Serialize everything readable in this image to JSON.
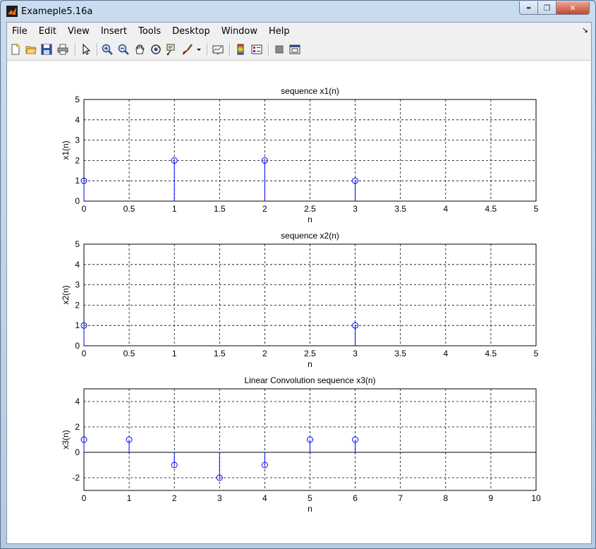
{
  "window": {
    "title": "Exameple5.16a",
    "controls": {
      "minimize": "▬",
      "maximize": "❐",
      "close": "✕"
    }
  },
  "menu": [
    "File",
    "Edit",
    "View",
    "Insert",
    "Tools",
    "Desktop",
    "Window",
    "Help"
  ],
  "toolbar": {
    "icons": [
      "new-figure-icon",
      "open-file-icon",
      "save-icon",
      "print-icon",
      "select-arrow-icon",
      "zoom-in-icon",
      "zoom-out-icon",
      "pan-icon",
      "rotate-3d-icon",
      "data-cursor-icon",
      "brush-icon",
      "link-plot-icon",
      "colorbar-icon",
      "legend-icon",
      "hide-plot-tools-icon",
      "show-plot-tools-icon"
    ]
  },
  "colors": {
    "stem": "#0000ff",
    "grid": "#000000",
    "window_frame": "#b6cbe2"
  },
  "chart_data": [
    {
      "type": "stem",
      "title": "sequence x1(n)",
      "xlabel": "n",
      "ylabel": "x1(n)",
      "x": [
        0,
        1,
        2,
        3
      ],
      "y": [
        1,
        2,
        2,
        1
      ],
      "xlim": [
        0,
        5
      ],
      "ylim": [
        0,
        5
      ],
      "xticks": [
        0,
        0.5,
        1,
        1.5,
        2,
        2.5,
        3,
        3.5,
        4,
        4.5,
        5
      ],
      "xtick_labels": [
        "0",
        "0.5",
        "1",
        "1.5",
        "2",
        "2.5",
        "3",
        "3.5",
        "4",
        "4.5",
        "5"
      ],
      "yticks": [
        0,
        1,
        2,
        3,
        4,
        5
      ],
      "ytick_labels": [
        "0",
        "1",
        "2",
        "3",
        "4",
        "5"
      ],
      "grid": true
    },
    {
      "type": "stem",
      "title": "sequence x2(n)",
      "xlabel": "n",
      "ylabel": "x2(n)",
      "x": [
        0,
        3
      ],
      "y": [
        1,
        1
      ],
      "xlim": [
        0,
        5
      ],
      "ylim": [
        0,
        5
      ],
      "xticks": [
        0,
        0.5,
        1,
        1.5,
        2,
        2.5,
        3,
        3.5,
        4,
        4.5,
        5
      ],
      "xtick_labels": [
        "0",
        "0.5",
        "1",
        "1.5",
        "2",
        "2.5",
        "3",
        "3.5",
        "4",
        "4.5",
        "5"
      ],
      "yticks": [
        0,
        1,
        2,
        3,
        4,
        5
      ],
      "ytick_labels": [
        "0",
        "1",
        "2",
        "3",
        "4",
        "5"
      ],
      "grid": true
    },
    {
      "type": "stem",
      "title": "Linear Convolution sequence x3(n)",
      "xlabel": "n",
      "ylabel": "x3(n)",
      "x": [
        0,
        1,
        2,
        3,
        4,
        5,
        6
      ],
      "y": [
        1,
        1,
        -1,
        -2,
        -1,
        1,
        1
      ],
      "xlim": [
        0,
        10
      ],
      "ylim": [
        -3,
        5
      ],
      "xticks": [
        0,
        1,
        2,
        3,
        4,
        5,
        6,
        7,
        8,
        9,
        10
      ],
      "xtick_labels": [
        "0",
        "1",
        "2",
        "3",
        "4",
        "5",
        "6",
        "7",
        "8",
        "9",
        "10"
      ],
      "yticks": [
        -2,
        0,
        2,
        4
      ],
      "ytick_labels": [
        "-2",
        "0",
        "2",
        "4"
      ],
      "grid": true
    }
  ]
}
